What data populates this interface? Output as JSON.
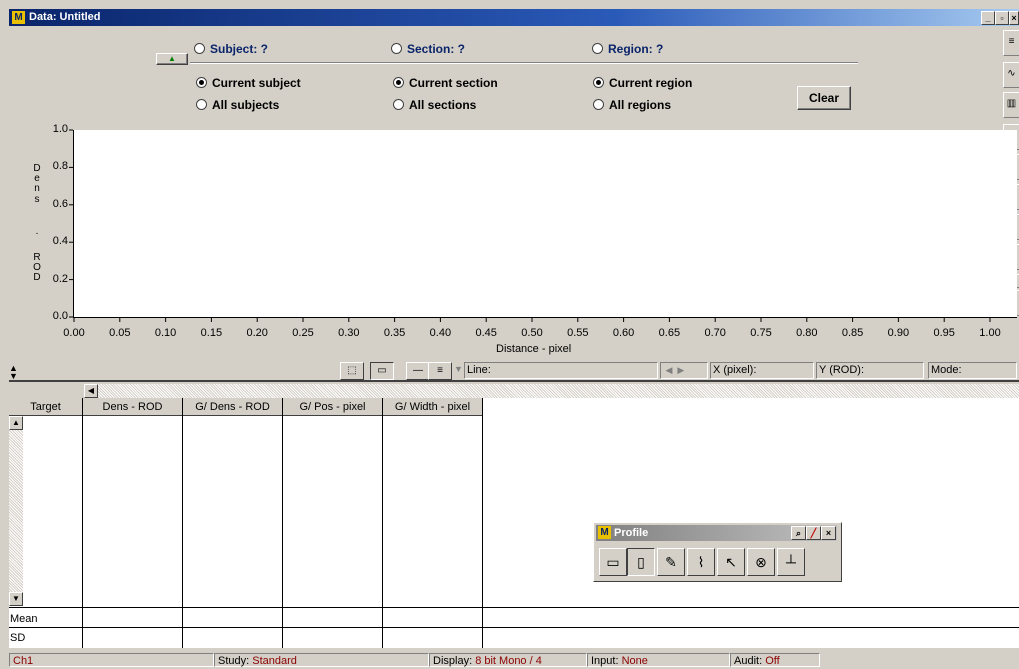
{
  "window": {
    "app_icon": "M",
    "title": "Data: Untitled"
  },
  "selectors": {
    "subject": {
      "header": "Subject: ?",
      "current": "Current subject",
      "all": "All subjects"
    },
    "section": {
      "header": "Section: ?",
      "current": "Current section",
      "all": "All sections"
    },
    "region": {
      "header": "Region: ?",
      "current": "Current region",
      "all": "All regions"
    },
    "clear_label": "Clear"
  },
  "chart_data": {
    "type": "line",
    "x": [],
    "series": [],
    "xlabel": "Distance - pixel",
    "ylabel": "Dens. ROD",
    "ylim": [
      0,
      1
    ],
    "xlim": [
      0,
      1
    ],
    "yticks": [
      "0.0",
      "0.2",
      "0.4",
      "0.6",
      "0.8",
      "1.0"
    ],
    "xticks": [
      "0.00",
      "0.05",
      "0.10",
      "0.15",
      "0.20",
      "0.25",
      "0.30",
      "0.35",
      "0.40",
      "0.45",
      "0.50",
      "0.55",
      "0.60",
      "0.65",
      "0.70",
      "0.75",
      "0.80",
      "0.85",
      "0.90",
      "0.95",
      "1.00"
    ],
    "grid": false
  },
  "ylabel_chars": [
    "D",
    "e",
    "n",
    "s",
    ".",
    "R",
    "O",
    "D"
  ],
  "readouts": {
    "line": "Line:",
    "x": "X (pixel):",
    "y": "Y (ROD):",
    "mode": "Mode:"
  },
  "table": {
    "columns": [
      "Target",
      "Dens - ROD",
      "G/ Dens - ROD",
      "G/ Pos - pixel",
      "G/ Width - pixel"
    ],
    "summary_rows": [
      "Mean",
      "SD"
    ]
  },
  "profile_toolbar": {
    "icon": "M",
    "title": "Profile"
  },
  "status": {
    "channel": "Ch1",
    "study_label": "Study:",
    "study_value": "Standard",
    "display_label": "Display:",
    "display_value": "8 bit Mono / 4",
    "input_label": "Input:",
    "input_value": "None",
    "audit_label": "Audit:",
    "audit_value": "Off"
  },
  "colors": {
    "title_blue": "#0a246a",
    "status_value": "#8b0000",
    "panel": "#d4d0c8"
  }
}
